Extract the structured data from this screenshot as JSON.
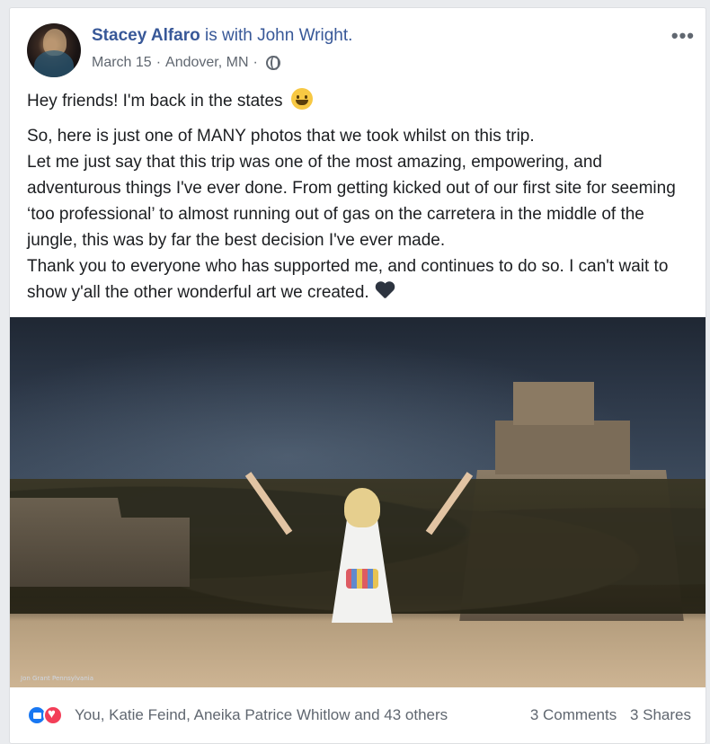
{
  "post": {
    "author": "Stacey Alfaro",
    "with_text": "is with",
    "tagged": "John Wright.",
    "date": "March 15",
    "location": "Andover, MN",
    "privacy_icon": "globe-icon",
    "more_label": "•••",
    "line1": "Hey friends! I'm back in the states",
    "body": "So, here is just one of MANY photos that we took whilst on this trip.\nLet me just say that this trip was one of the most amazing, empowering, and adventurous things I've ever done. From getting kicked out of our first site for seeming ‘too professional’ to almost running out of gas on the carretera in the middle of the jungle, this was by far the best decision I've ever made.\nThank you to everyone who has supported me, and continues to do so. I can't wait to show y'all the other wonderful art we created.",
    "photo_watermark": "Jon Grant Pennsylvania"
  },
  "footer": {
    "reactors": "You, Katie Feind, Aneika Patrice Whitlow and 43 others",
    "comments": "3 Comments",
    "shares": "3 Shares"
  },
  "colors": {
    "link": "#385898",
    "meta": "#606770",
    "like": "#1877f2",
    "love": "#f33e58"
  }
}
